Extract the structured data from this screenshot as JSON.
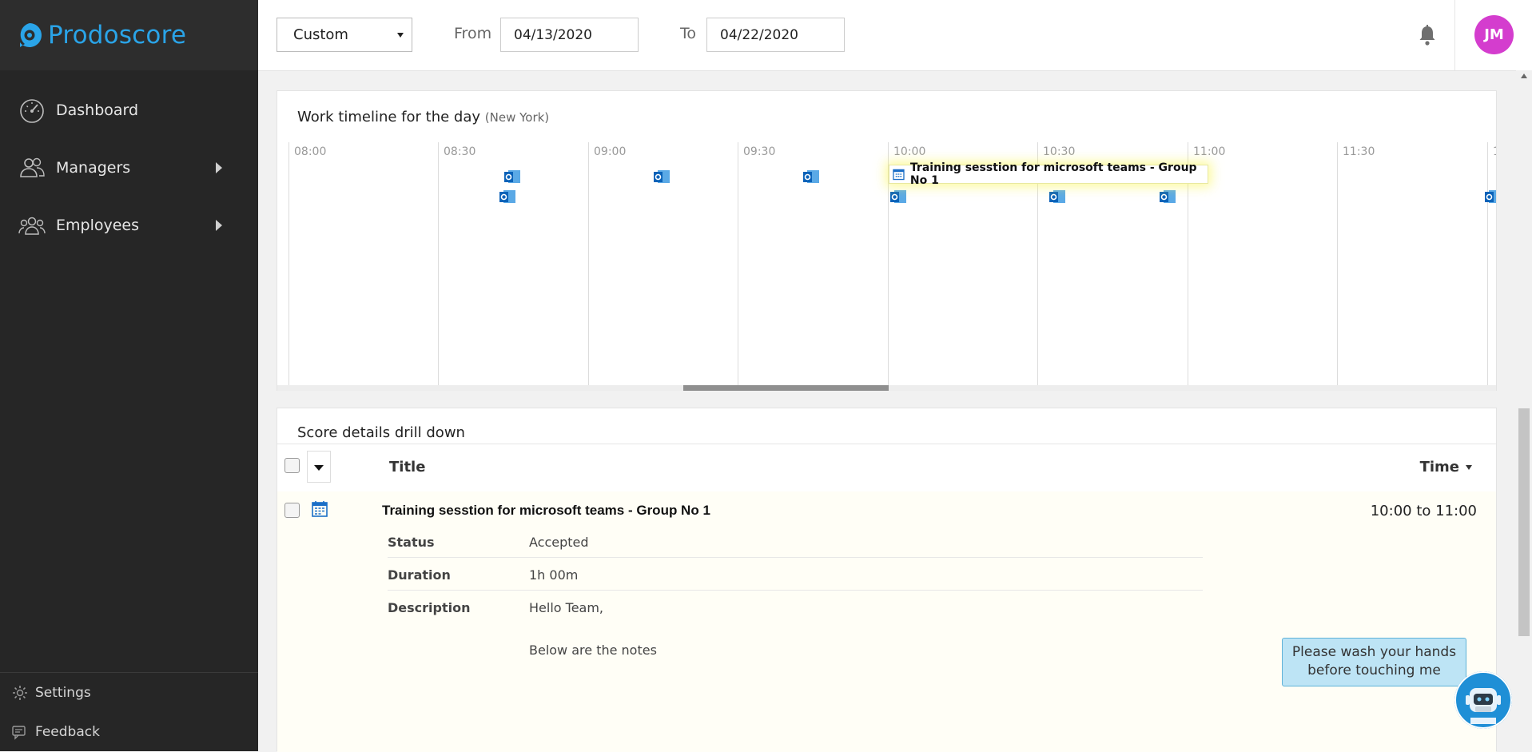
{
  "app": {
    "logo_text": "Prodoscore"
  },
  "sidebar": {
    "items": [
      {
        "label": "Dashboard",
        "icon": "speedometer-icon",
        "expandable": false
      },
      {
        "label": "Managers",
        "icon": "managers-icon",
        "expandable": true
      },
      {
        "label": "Employees",
        "icon": "employees-icon",
        "expandable": true
      }
    ],
    "bottom": [
      {
        "label": "Settings",
        "icon": "gear-icon"
      },
      {
        "label": "Feedback",
        "icon": "feedback-icon"
      }
    ]
  },
  "topbar": {
    "range_value": "Custom",
    "from_label": "From",
    "from_value": "04/13/2020",
    "to_label": "To",
    "to_value": "04/22/2020",
    "avatar_initials": "JM"
  },
  "timeline": {
    "title": "Work timeline for the day",
    "timezone": "(New York)",
    "ticks": [
      "08:00",
      "08:30",
      "09:00",
      "09:30",
      "10:00",
      "10:30",
      "11:00",
      "11:30",
      "1"
    ],
    "event_label": "Training sesstion for microsoft teams - Group No 1"
  },
  "score": {
    "title": "Score details drill down",
    "col_title": "Title",
    "col_time": "Time",
    "row": {
      "title": "Training sesstion for microsoft teams - Group No 1",
      "time": "10:00 to 11:00",
      "details": [
        {
          "key": "Status",
          "value": "Accepted"
        },
        {
          "key": "Duration",
          "value": "1h 00m"
        },
        {
          "key": "Description",
          "value": "Hello Team,"
        }
      ],
      "description_extra": "Below are the notes"
    }
  },
  "bot": {
    "message_line1": "Please wash your hands",
    "message_line2": "before touching me"
  },
  "colors": {
    "brand": "#2aa4e8",
    "sidebar": "#262626",
    "avatar": "#d43dce",
    "highlight": "#fffef6"
  }
}
